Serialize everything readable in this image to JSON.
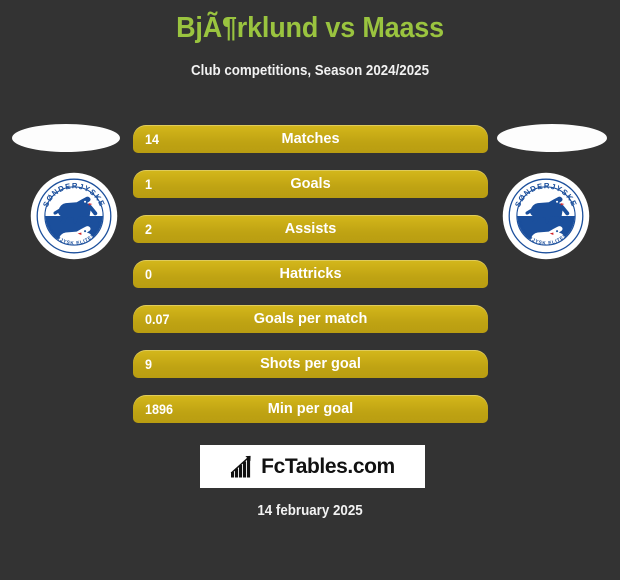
{
  "page": {
    "background_color": "#333333",
    "title": "BjÃ¶rklund vs Maass",
    "title_color": "#9ac43f",
    "subtitle": "Club competitions, Season 2024/2025",
    "subtitle_color": "#f2f2f2"
  },
  "players": {
    "left": {
      "photo_placeholder": "player-photo-placeholder",
      "club_badge_name": "sonderjyske-badge",
      "badge_top_text": "SØNDERJYSKE",
      "badge_bottom_text": "SØNDERJYSK ELITESPORT",
      "badge_colors": {
        "blue": "#1b4f9c",
        "dark_blue": "#16407e",
        "white": "#ffffff"
      }
    },
    "right": {
      "photo_placeholder": "player-photo-placeholder",
      "club_badge_name": "sonderjyske-badge",
      "badge_top_text": "SØNDERJYSKE",
      "badge_bottom_text": "SØNDERJYSK ELITESPORT",
      "badge_colors": {
        "blue": "#1b4f9c",
        "dark_blue": "#16407e",
        "white": "#ffffff"
      }
    }
  },
  "chart_data": {
    "type": "bar",
    "title": "BjÃ¶rklund vs Maass",
    "subtitle": "Club competitions, Season 2024/2025",
    "xlabel": "",
    "ylabel": "",
    "bar_color": "#c9ac16",
    "text_color": "#ffffff",
    "categories": [
      "Matches",
      "Goals",
      "Assists",
      "Hattricks",
      "Goals per match",
      "Shots per goal",
      "Min per goal"
    ],
    "values": [
      14,
      1,
      2,
      0,
      0.07,
      9,
      1896
    ],
    "value_labels": [
      "14",
      "1",
      "2",
      "0",
      "0.07",
      "9",
      "1896"
    ]
  },
  "stats": [
    {
      "value": "14",
      "label": "Matches"
    },
    {
      "value": "1",
      "label": "Goals"
    },
    {
      "value": "2",
      "label": "Assists"
    },
    {
      "value": "0",
      "label": "Hattricks"
    },
    {
      "value": "0.07",
      "label": "Goals per match"
    },
    {
      "value": "9",
      "label": "Shots per goal"
    },
    {
      "value": "1896",
      "label": "Min per goal"
    }
  ],
  "footer": {
    "logo_text": "FcTables.com",
    "logo_icon": "bar-chart-growth-icon",
    "logo_background": "#ffffff",
    "date": "14 february 2025"
  }
}
